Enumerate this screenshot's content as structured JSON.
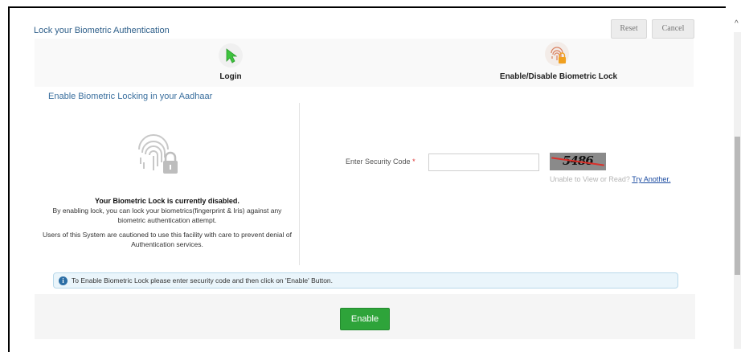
{
  "header": {
    "title": "Lock your Biometric Authentication",
    "reset_label": "Reset",
    "cancel_label": "Cancel"
  },
  "steps": [
    {
      "label": "Login",
      "icon": "cursor-arrow-icon"
    },
    {
      "label": "Enable/Disable Biometric Lock",
      "icon": "fingerprint-lock-icon"
    }
  ],
  "section": {
    "title": "Enable Biometric Locking in your Aadhaar"
  },
  "status": {
    "heading": "Your Biometric Lock is currently disabled.",
    "description": "By enabling lock, you can lock your biometrics(fingerprint & Iris) against any biometric authentication attempt.",
    "warning": "Users of this System are cautioned to use this facility with care to prevent denial of Authentication services."
  },
  "security_code": {
    "label": "Enter Security Code",
    "required_marker": "*",
    "value": "",
    "captcha_text": "5486",
    "help_text": "Unable to View or Read?",
    "try_another": "Try Another."
  },
  "info": {
    "text": "To Enable Biometric Lock please enter security code and then click on 'Enable' Button."
  },
  "actions": {
    "enable_label": "Enable"
  },
  "colors": {
    "accent": "#2e5f8a",
    "enable_button": "#2ea43a",
    "info_background": "#eaf5fb"
  }
}
